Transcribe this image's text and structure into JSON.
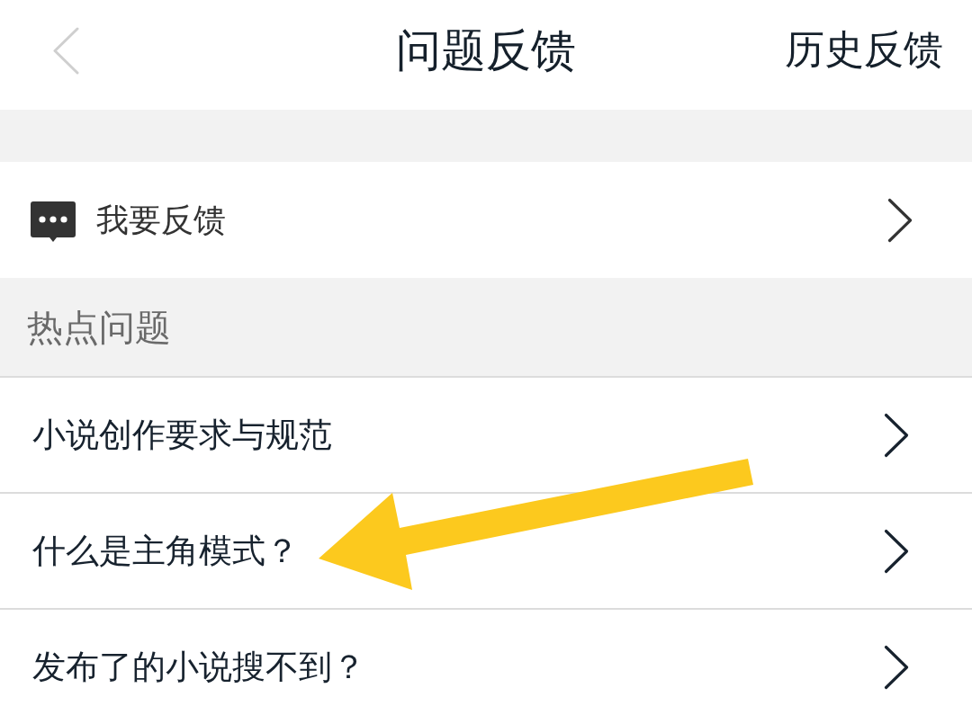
{
  "header": {
    "title": "问题反馈",
    "action": "历史反馈"
  },
  "feedback_entry": {
    "label": "我要反馈"
  },
  "hot_questions": {
    "title": "热点问题",
    "items": [
      {
        "label": "小说创作要求与规范"
      },
      {
        "label": "什么是主角模式？"
      },
      {
        "label": "发布了的小说搜不到？"
      }
    ]
  }
}
